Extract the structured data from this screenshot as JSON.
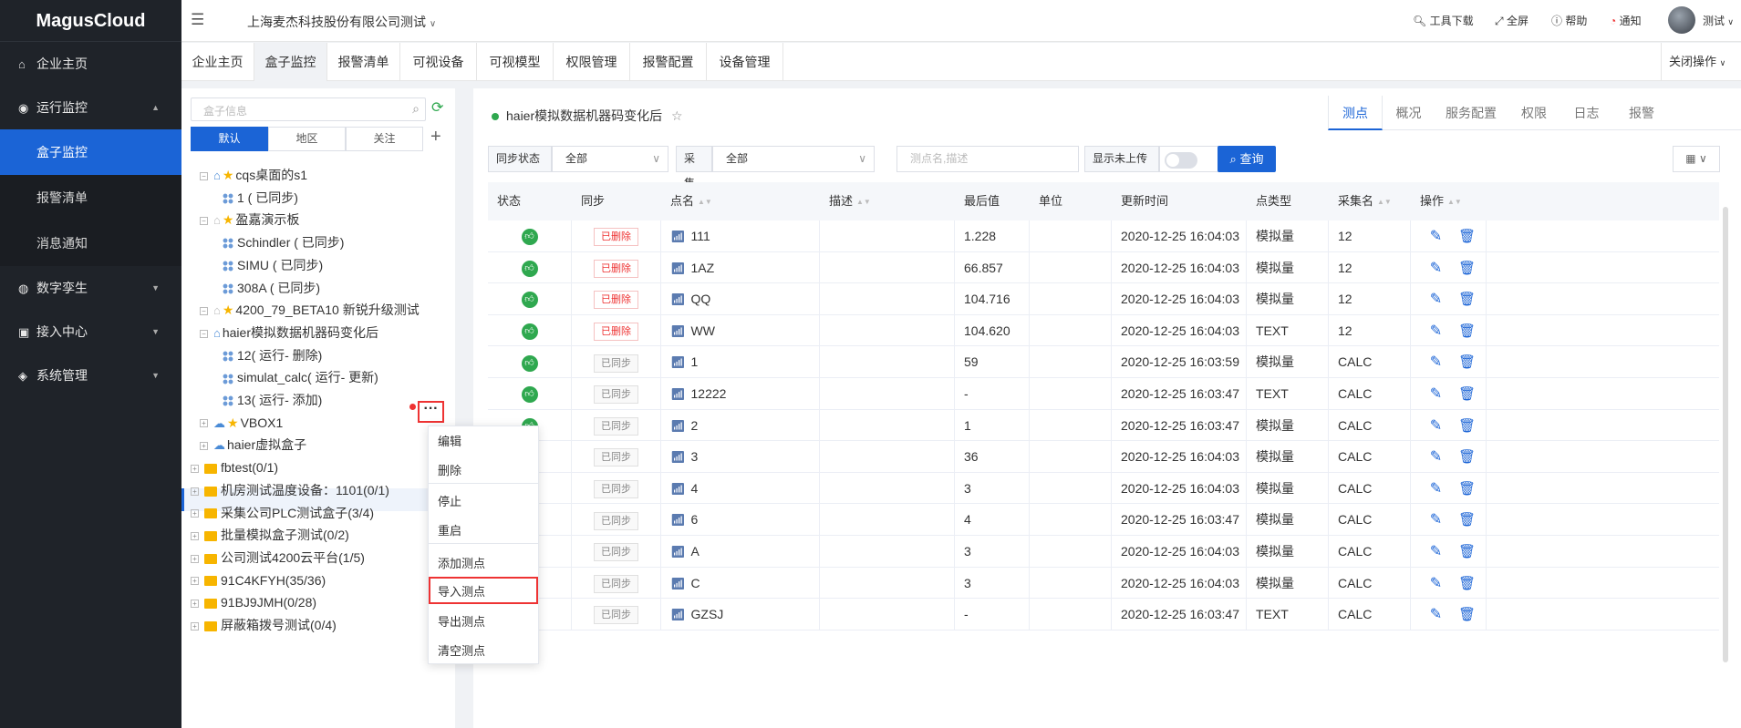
{
  "app": {
    "logo": "MagusCloud"
  },
  "sidebar": {
    "items": [
      {
        "label": "企业主页",
        "icon": "home-icon",
        "glyph": "⌂",
        "arrow": ""
      },
      {
        "label": "运行监控",
        "icon": "bulb-icon",
        "glyph": "◉",
        "arrow": "▲"
      },
      {
        "label": "盒子监控",
        "sub": true,
        "active": true
      },
      {
        "label": "报警清单",
        "sub": true
      },
      {
        "label": "消息通知",
        "sub": true
      },
      {
        "label": "数字孪生",
        "icon": "globe-icon",
        "glyph": "◍",
        "arrow": "▼"
      },
      {
        "label": "接入中心",
        "icon": "plug-icon",
        "glyph": "▣",
        "arrow": "▼"
      },
      {
        "label": "系统管理",
        "icon": "layers-icon",
        "glyph": "◈",
        "arrow": "▼"
      }
    ]
  },
  "header": {
    "company": "上海麦杰科技股份有限公司测试",
    "tools": "工具下载",
    "fullscreen": "全屏",
    "help": "帮助",
    "notify": "通知",
    "user": "测试"
  },
  "tabs": [
    "企业主页",
    "盒子监控",
    "报警清单",
    "可视设备",
    "可视模型",
    "权限管理",
    "报警配置",
    "设备管理"
  ],
  "tabs_close": "关闭操作",
  "tree": {
    "search_placeholder": "盒子信息",
    "tabs": [
      "默认",
      "地区",
      "关注"
    ],
    "nodes": [
      {
        "label": "cqs桌面的s1",
        "kind": "box",
        "star": true
      },
      {
        "label": "1 ( 已同步)",
        "kind": "coll"
      },
      {
        "label": "盈嘉演示板",
        "kind": "boxgray",
        "star": true
      },
      {
        "label": "Schindler ( 已同步)",
        "kind": "coll"
      },
      {
        "label": "SIMU ( 已同步)",
        "kind": "coll"
      },
      {
        "label": "308A ( 已同步)",
        "kind": "coll"
      },
      {
        "label": "4200_79_BETA10 新锐升级测试",
        "kind": "boxgray",
        "star": true
      },
      {
        "label": "haier模拟数据机器码变化后",
        "kind": "box"
      },
      {
        "label": "12( 运行- 删除)",
        "kind": "coll"
      },
      {
        "label": "simulat_calc( 运行- 更新)",
        "kind": "coll"
      },
      {
        "label": "13( 运行- 添加)",
        "kind": "coll"
      },
      {
        "label": "VBOX1",
        "kind": "cloud",
        "star": true
      },
      {
        "label": "haier虚拟盒子",
        "kind": "cloud"
      },
      {
        "label": "fbtest(0/1)",
        "kind": "folder"
      },
      {
        "label": "机房测试温度设备：1101(0/1)",
        "kind": "folder"
      },
      {
        "label": "采集公司PLC测试盒子(3/4)",
        "kind": "folder"
      },
      {
        "label": "批量模拟盒子测试(0/2)",
        "kind": "folder"
      },
      {
        "label": "公司测试4200云平台(1/5)",
        "kind": "folder"
      },
      {
        "label": "91C4KFYH(35/36)",
        "kind": "folder"
      },
      {
        "label": "91BJ9JMH(0/28)",
        "kind": "folder"
      },
      {
        "label": "屏蔽箱拨号测试(0/4)",
        "kind": "folder"
      }
    ]
  },
  "context_menu": [
    "编辑",
    "删除",
    "停止",
    "重启",
    "添加测点",
    "导入测点",
    "导出测点",
    "清空测点"
  ],
  "panel": {
    "title": "haier模拟数据机器码变化后",
    "tabs": [
      "测点",
      "概况",
      "服务配置",
      "权限",
      "日志",
      "报警"
    ]
  },
  "filters": {
    "sync_label": "同步状态",
    "sync_value": "全部",
    "collect_label": "采集",
    "collect_value": "全部",
    "search_placeholder": "测点名,描述",
    "show_unuploaded": "显示未上传",
    "query": "查询"
  },
  "table": {
    "headers": [
      "状态",
      "同步",
      "点名",
      "描述",
      "最后值",
      "单位",
      "更新时间",
      "点类型",
      "采集名",
      "操作"
    ],
    "rows": [
      {
        "sync": "已删除",
        "name": "111",
        "value": "1.228",
        "time": "2020-12-25 16:04:03",
        "type": "模拟量",
        "coll": "12"
      },
      {
        "sync": "已删除",
        "name": "1AZ",
        "value": "66.857",
        "time": "2020-12-25 16:04:03",
        "type": "模拟量",
        "coll": "12"
      },
      {
        "sync": "已删除",
        "name": "QQ",
        "value": "104.716",
        "time": "2020-12-25 16:04:03",
        "type": "模拟量",
        "coll": "12"
      },
      {
        "sync": "已删除",
        "name": "WW",
        "value": "104.620",
        "time": "2020-12-25 16:04:03",
        "type": "TEXT",
        "coll": "12"
      },
      {
        "sync": "已同步",
        "name": "1",
        "value": "59",
        "time": "2020-12-25 16:03:59",
        "type": "模拟量",
        "coll": "CALC"
      },
      {
        "sync": "已同步",
        "name": "12222",
        "value": "-",
        "time": "2020-12-25 16:03:47",
        "type": "TEXT",
        "coll": "CALC"
      },
      {
        "sync": "已同步",
        "name": "2",
        "value": "1",
        "time": "2020-12-25 16:03:47",
        "type": "模拟量",
        "coll": "CALC"
      },
      {
        "sync": "已同步",
        "name": "3",
        "value": "36",
        "time": "2020-12-25 16:04:03",
        "type": "模拟量",
        "coll": "CALC"
      },
      {
        "sync": "已同步",
        "name": "4",
        "value": "3",
        "time": "2020-12-25 16:04:03",
        "type": "模拟量",
        "coll": "CALC"
      },
      {
        "sync": "已同步",
        "name": "6",
        "value": "4",
        "time": "2020-12-25 16:03:47",
        "type": "模拟量",
        "coll": "CALC"
      },
      {
        "sync": "已同步",
        "name": "A",
        "value": "3",
        "time": "2020-12-25 16:04:03",
        "type": "模拟量",
        "coll": "CALC"
      },
      {
        "sync": "已同步",
        "name": "C",
        "value": "3",
        "time": "2020-12-25 16:04:03",
        "type": "模拟量",
        "coll": "CALC"
      },
      {
        "sync": "已同步",
        "name": "GZSJ",
        "value": "-",
        "time": "2020-12-25 16:03:47",
        "type": "TEXT",
        "coll": "CALC"
      }
    ]
  }
}
